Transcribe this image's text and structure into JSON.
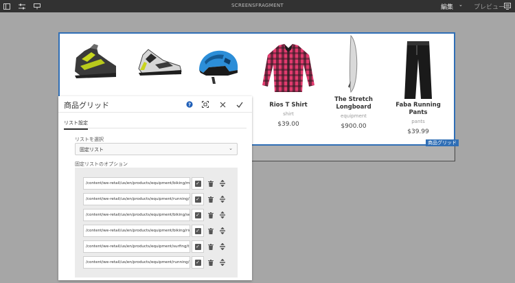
{
  "topbar": {
    "title": "SCREENSFRAGMENT",
    "edit_label": "編集",
    "preview_label": "プレビュー",
    "icons": [
      "sidebar-toggle-icon",
      "properties-icon",
      "content-tree-icon",
      "emulator-icon"
    ]
  },
  "canvas": {
    "component_badge": "商品グリッド",
    "products": [
      {
        "name": "",
        "category": "",
        "price": "",
        "icon": "cycling-shoe"
      },
      {
        "name": "",
        "category": "",
        "price": "",
        "icon": "running-shoe"
      },
      {
        "name": "",
        "category": "",
        "price": "",
        "icon": "bike-helmet"
      },
      {
        "name": "Rios T Shirt",
        "category": "shirt",
        "price": "$39.00",
        "icon": "flannel-shirt"
      },
      {
        "name": "The Stretch Longboard",
        "category": "equipment",
        "price": "$900.00",
        "icon": "longboard"
      },
      {
        "name": "Faba Running Pants",
        "category": "pants",
        "price": "$39.99",
        "icon": "running-pants"
      }
    ]
  },
  "dialog": {
    "title": "商品グリッド",
    "tab_label": "リスト設定",
    "select_label": "リストを選択",
    "select_value": "固定リスト",
    "options_label": "固定リストのオプション",
    "paths": [
      "/content/we-retail/us/en/products/equipment/biking/marin",
      "/content/we-retail/us/en/products/equipment/running/fleet",
      "/content/we-retail/us/en/products/equipment/biking/sequoia",
      "/content/we-retail/us/en/products/equipment/biking/rios",
      "/content/we-retail/us/en/products/equipment/surfing/the-stretch",
      "/content/we-retail/us/en/products/equipment/running/faba"
    ],
    "colors": {
      "accent": "#2f6eb5",
      "help": "#1f5fb8"
    }
  }
}
